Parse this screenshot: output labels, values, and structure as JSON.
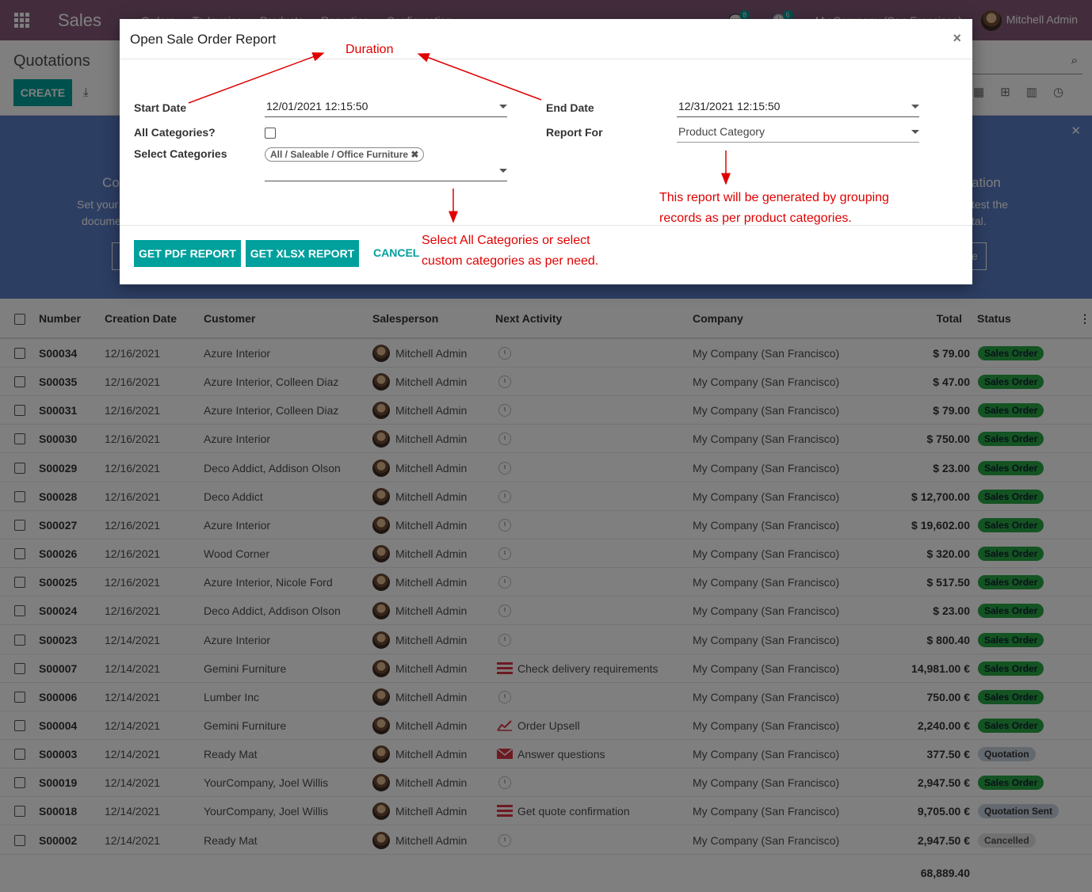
{
  "topbar": {
    "app_name": "Sales",
    "menu": [
      "Orders",
      "To Invoice",
      "Products",
      "Reporting",
      "Configuration"
    ],
    "chat_count": "8",
    "activity_count": "6",
    "company": "My Company (San Francisco)",
    "user": "Mitchell Admin"
  },
  "control_panel": {
    "breadcrumb": "Quotations",
    "create_label": "CREATE"
  },
  "banner": {
    "left_title": "Co",
    "left_text_1": "Set your",
    "left_text_2": "docume",
    "right_title": "ation",
    "right_text_1": "test the",
    "right_text_2": "tal.",
    "right_button": "e"
  },
  "table": {
    "headers": {
      "number": "Number",
      "creation_date": "Creation Date",
      "customer": "Customer",
      "salesperson": "Salesperson",
      "next_activity": "Next Activity",
      "company": "Company",
      "total": "Total",
      "status": "Status"
    },
    "rows": [
      {
        "number": "S00034",
        "date": "12/16/2021",
        "customer": "Azure Interior",
        "salesperson": "Mitchell Admin",
        "activity": "",
        "activity_icon": "clock",
        "company": "My Company (San Francisco)",
        "total": "$ 79.00",
        "status": "Sales Order",
        "status_kind": "so"
      },
      {
        "number": "S00035",
        "date": "12/16/2021",
        "customer": "Azure Interior, Colleen Diaz",
        "salesperson": "Mitchell Admin",
        "activity": "",
        "activity_icon": "clock",
        "company": "My Company (San Francisco)",
        "total": "$ 47.00",
        "status": "Sales Order",
        "status_kind": "so"
      },
      {
        "number": "S00031",
        "date": "12/16/2021",
        "customer": "Azure Interior, Colleen Diaz",
        "salesperson": "Mitchell Admin",
        "activity": "",
        "activity_icon": "clock",
        "company": "My Company (San Francisco)",
        "total": "$ 79.00",
        "status": "Sales Order",
        "status_kind": "so"
      },
      {
        "number": "S00030",
        "date": "12/16/2021",
        "customer": "Azure Interior",
        "salesperson": "Mitchell Admin",
        "activity": "",
        "activity_icon": "clock",
        "company": "My Company (San Francisco)",
        "total": "$ 750.00",
        "status": "Sales Order",
        "status_kind": "so"
      },
      {
        "number": "S00029",
        "date": "12/16/2021",
        "customer": "Deco Addict, Addison Olson",
        "salesperson": "Mitchell Admin",
        "activity": "",
        "activity_icon": "clock",
        "company": "My Company (San Francisco)",
        "total": "$ 23.00",
        "status": "Sales Order",
        "status_kind": "so"
      },
      {
        "number": "S00028",
        "date": "12/16/2021",
        "customer": "Deco Addict",
        "salesperson": "Mitchell Admin",
        "activity": "",
        "activity_icon": "clock",
        "company": "My Company (San Francisco)",
        "total": "$ 12,700.00",
        "status": "Sales Order",
        "status_kind": "so"
      },
      {
        "number": "S00027",
        "date": "12/16/2021",
        "customer": "Azure Interior",
        "salesperson": "Mitchell Admin",
        "activity": "",
        "activity_icon": "clock",
        "company": "My Company (San Francisco)",
        "total": "$ 19,602.00",
        "status": "Sales Order",
        "status_kind": "so"
      },
      {
        "number": "S00026",
        "date": "12/16/2021",
        "customer": "Wood Corner",
        "salesperson": "Mitchell Admin",
        "activity": "",
        "activity_icon": "clock",
        "company": "My Company (San Francisco)",
        "total": "$ 320.00",
        "status": "Sales Order",
        "status_kind": "so"
      },
      {
        "number": "S00025",
        "date": "12/16/2021",
        "customer": "Azure Interior, Nicole Ford",
        "salesperson": "Mitchell Admin",
        "activity": "",
        "activity_icon": "clock",
        "company": "My Company (San Francisco)",
        "total": "$ 517.50",
        "status": "Sales Order",
        "status_kind": "so"
      },
      {
        "number": "S00024",
        "date": "12/16/2021",
        "customer": "Deco Addict, Addison Olson",
        "salesperson": "Mitchell Admin",
        "activity": "",
        "activity_icon": "clock",
        "company": "My Company (San Francisco)",
        "total": "$ 23.00",
        "status": "Sales Order",
        "status_kind": "so"
      },
      {
        "number": "S00023",
        "date": "12/14/2021",
        "customer": "Azure Interior",
        "salesperson": "Mitchell Admin",
        "activity": "",
        "activity_icon": "clock",
        "company": "My Company (San Francisco)",
        "total": "$ 800.40",
        "status": "Sales Order",
        "status_kind": "so"
      },
      {
        "number": "S00007",
        "date": "12/14/2021",
        "customer": "Gemini Furniture",
        "salesperson": "Mitchell Admin",
        "activity": "Check delivery requirements",
        "activity_icon": "tasks",
        "company": "My Company (San Francisco)",
        "total": "14,981.00 €",
        "status": "Sales Order",
        "status_kind": "so"
      },
      {
        "number": "S00006",
        "date": "12/14/2021",
        "customer": "Lumber Inc",
        "salesperson": "Mitchell Admin",
        "activity": "",
        "activity_icon": "clock",
        "company": "My Company (San Francisco)",
        "total": "750.00 €",
        "status": "Sales Order",
        "status_kind": "so"
      },
      {
        "number": "S00004",
        "date": "12/14/2021",
        "customer": "Gemini Furniture",
        "salesperson": "Mitchell Admin",
        "activity": "Order Upsell",
        "activity_icon": "chart",
        "company": "My Company (San Francisco)",
        "total": "2,240.00 €",
        "status": "Sales Order",
        "status_kind": "so"
      },
      {
        "number": "S00003",
        "date": "12/14/2021",
        "customer": "Ready Mat",
        "salesperson": "Mitchell Admin",
        "activity": "Answer questions",
        "activity_icon": "envelope",
        "company": "My Company (San Francisco)",
        "total": "377.50 €",
        "status": "Quotation",
        "status_kind": "q"
      },
      {
        "number": "S00019",
        "date": "12/14/2021",
        "customer": "YourCompany, Joel Willis",
        "salesperson": "Mitchell Admin",
        "activity": "",
        "activity_icon": "clock",
        "company": "My Company (San Francisco)",
        "total": "2,947.50 €",
        "status": "Sales Order",
        "status_kind": "so"
      },
      {
        "number": "S00018",
        "date": "12/14/2021",
        "customer": "YourCompany, Joel Willis",
        "salesperson": "Mitchell Admin",
        "activity": "Get quote confirmation",
        "activity_icon": "tasks",
        "company": "My Company (San Francisco)",
        "total": "9,705.00 €",
        "status": "Quotation Sent",
        "status_kind": "qs"
      },
      {
        "number": "S00002",
        "date": "12/14/2021",
        "customer": "Ready Mat",
        "salesperson": "Mitchell Admin",
        "activity": "",
        "activity_icon": "clock",
        "company": "My Company (San Francisco)",
        "total": "2,947.50 €",
        "status": "Cancelled",
        "status_kind": "c"
      }
    ],
    "grand_total": "68,889.40"
  },
  "modal": {
    "title": "Open Sale Order Report",
    "start_date_label": "Start Date",
    "start_date_value": "12/01/2021 12:15:50",
    "end_date_label": "End Date",
    "end_date_value": "12/31/2021 12:15:50",
    "all_categories_label": "All Categories?",
    "report_for_label": "Report For",
    "report_for_value": "Product Category",
    "select_categories_label": "Select Categories",
    "selected_category_tag": "All / Saleable / Office Furniture",
    "pdf_button": "GET PDF REPORT",
    "xlsx_button": "GET XLSX REPORT",
    "cancel_button": "CANCEL"
  },
  "annotations": {
    "duration": "Duration",
    "grouping_line_1": "This report will be generated by grouping",
    "grouping_line_2": "records as per product categories.",
    "categories_line_1": "Select All Categories or select",
    "categories_line_2": "custom categories as per need."
  },
  "colors": {
    "brand": "#875a7b",
    "primary": "#00a09d",
    "annotation": "#e00000",
    "status_sales_order": "#28a745"
  }
}
